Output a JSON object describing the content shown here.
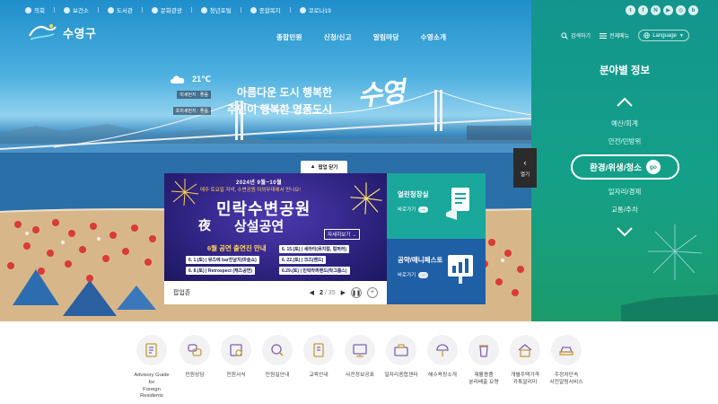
{
  "utilbar": {
    "items": [
      "의회",
      "보건소",
      "도서관",
      "문화관광",
      "청년포털",
      "종합복지"
    ],
    "covid": "코로나19"
  },
  "header": {
    "logo_text": "수영구",
    "nav": [
      "종합민원",
      "신청/신고",
      "알림마당",
      "수영소개"
    ],
    "search_label": "검색하기",
    "allmenu_label": "전체메뉴",
    "language_label": "Language",
    "sns": [
      "t",
      "f",
      "N",
      "▶",
      "◎",
      "b"
    ]
  },
  "weather": {
    "temp": "21℃",
    "fine_dust": "미세먼지 : 좋음",
    "ultra_fine_dust": "초미세먼지 : 좋음"
  },
  "slogan": {
    "line1": "아름다운 도시 행복한",
    "line2": "주민이 행복한 명품도시",
    "brush": "수영"
  },
  "popup": {
    "close_label": "팝업 닫기",
    "poster": {
      "date": "2024년 9월~10월",
      "sub": "매주 토요일 저녁, 수변공원 야외무대에서 만나요!",
      "title": "민락수변공원",
      "night": "夜",
      "title2": "상설공연",
      "more": "자세히보기 →",
      "guide": "6월 공연 출연진 안내",
      "schedule": [
        "6. 1.(토) | 뮤즈에 bar진날지(마술쇼)",
        "6. 8.(토) | Retrospect (재즈공연)",
        "6. 15.(토) | 세라티(뮤지컬, 컬퍼러)",
        "6. 22.(토) | 크즈(밴드)",
        "6.29.(토) | 민락라퍼밴드(락그룹스)"
      ]
    },
    "side": [
      {
        "title": "열린청장실",
        "go": "바로가기"
      },
      {
        "title": "공약/매니페스토",
        "go": "바로가기"
      }
    ],
    "footer": {
      "label": "팝업존",
      "current": "2",
      "total": "/ 35"
    }
  },
  "open_tab": "열기",
  "right_panel": {
    "title": "분야별 정보",
    "items": [
      "예산/회계",
      "안전/민방위",
      "일자리/경제",
      "교통/주차"
    ],
    "active": "환경/위생/청소",
    "go": "go"
  },
  "quick_menu": [
    {
      "label": "Advisory Guide for\nForeign Residents",
      "icon": "document-icon"
    },
    {
      "label": "민원상담",
      "icon": "consult-icon"
    },
    {
      "label": "민원서식",
      "icon": "form-icon"
    },
    {
      "label": "민원실안내",
      "icon": "guide-icon"
    },
    {
      "label": "교육안내",
      "icon": "education-icon"
    },
    {
      "label": "사전정보공표",
      "icon": "info-icon"
    },
    {
      "label": "일자리종합센터",
      "icon": "job-icon"
    },
    {
      "label": "해수욕장소개",
      "icon": "beach-icon"
    },
    {
      "label": "재활용품\n분리배출 요령",
      "icon": "recycle-icon"
    },
    {
      "label": "개별주택가격\n카톡알리미",
      "icon": "house-icon"
    },
    {
      "label": "주정차단속\n사전알림서비스",
      "icon": "car-icon"
    }
  ]
}
